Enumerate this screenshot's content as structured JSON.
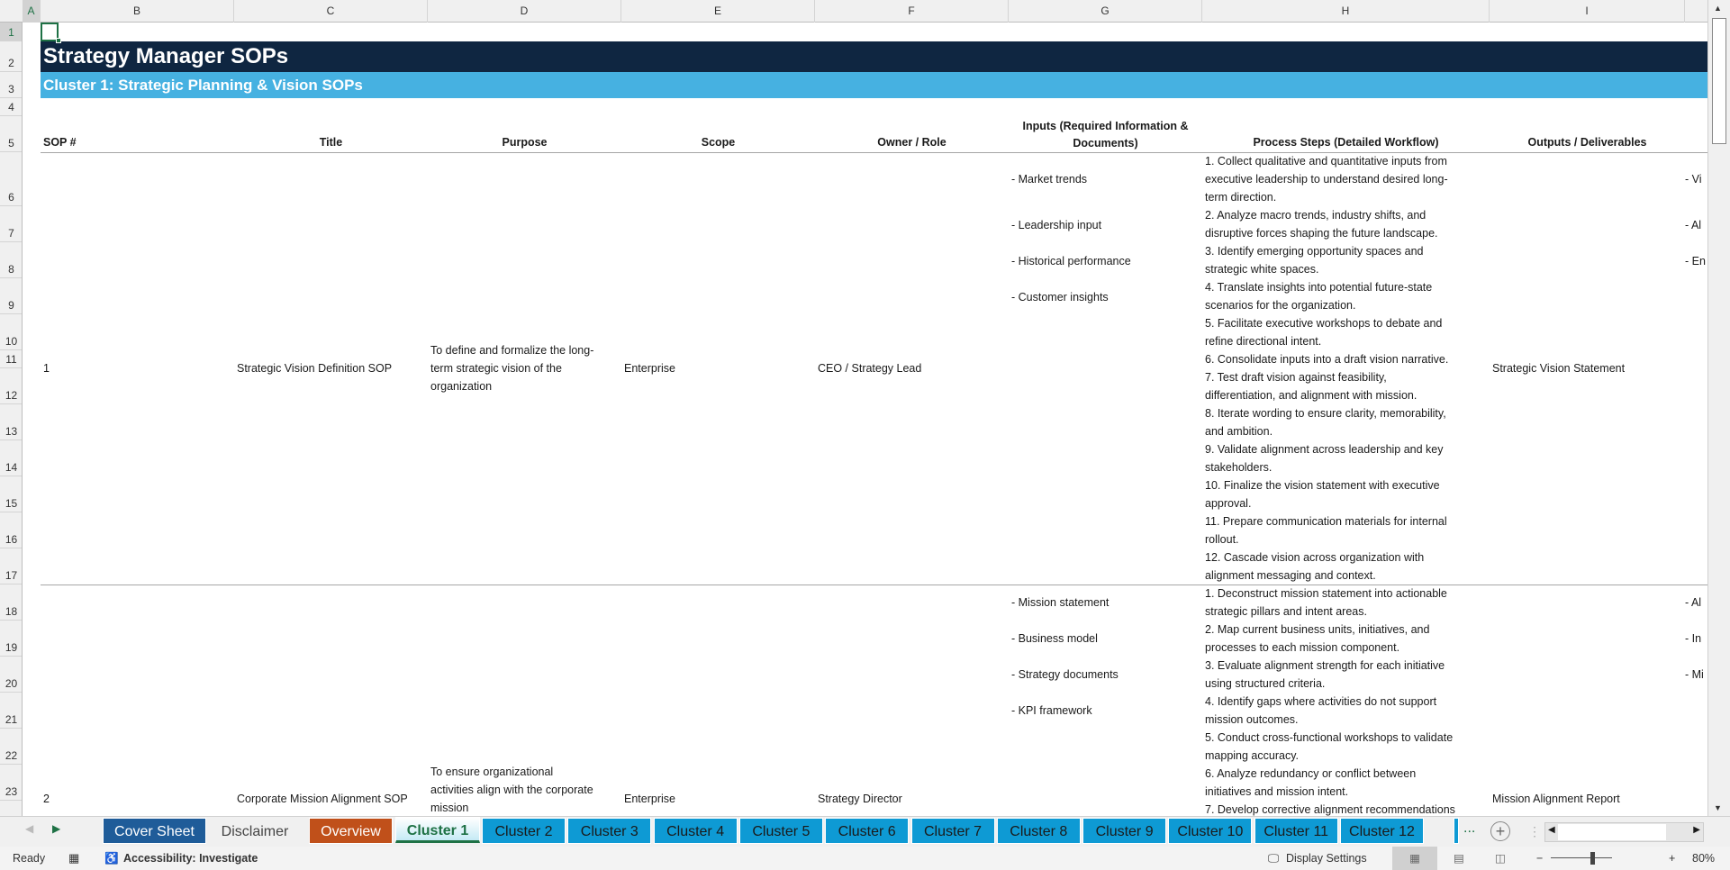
{
  "columns": [
    "A",
    "B",
    "C",
    "D",
    "E",
    "F",
    "G",
    "H",
    "I"
  ],
  "rows": [
    "1",
    "2",
    "3",
    "4",
    "5",
    "6",
    "7",
    "8",
    "9",
    "10",
    "11",
    "12",
    "13",
    "14",
    "15",
    "16",
    "17",
    "18",
    "19",
    "20",
    "21",
    "22",
    "23"
  ],
  "sheet": {
    "title": "Strategy Manager SOPs",
    "subtitle": "Cluster 1: Strategic Planning & Vision SOPs",
    "headers": {
      "sop": "SOP #",
      "title": "Title",
      "purpose": "Purpose",
      "scope": "Scope",
      "owner": "Owner / Role",
      "inputs": "Inputs (Required Information & Documents)",
      "steps": "Process Steps (Detailed Workflow)",
      "outputs": "Outputs / Deliverables"
    },
    "sops": [
      {
        "num": "1",
        "title": "Strategic Vision Definition SOP",
        "purpose": [
          "To define and formalize the long-",
          "term strategic vision of the",
          "organization"
        ],
        "scope": "Enterprise",
        "owner": "CEO / Strategy Lead",
        "inputs": [
          "- Market trends",
          "- Leadership input",
          "- Historical performance",
          "- Customer insights"
        ],
        "steps": [
          "1. Collect qualitative and quantitative inputs from",
          "executive leadership to understand desired long-",
          "term direction.",
          "2. Analyze macro trends, industry shifts, and",
          "disruptive forces shaping the future landscape.",
          "3. Identify emerging opportunity spaces and",
          "strategic white spaces.",
          "4. Translate insights into potential future-state",
          "scenarios for the organization.",
          "5. Facilitate executive workshops to debate and",
          "refine directional intent.",
          "6. Consolidate inputs into a draft vision narrative.",
          "7. Test draft vision against feasibility,",
          "differentiation, and alignment with mission.",
          "8. Iterate wording to ensure clarity, memorability,",
          "and ambition.",
          "9. Validate alignment across leadership and key",
          "stakeholders.",
          "10. Finalize the vision statement with executive",
          "approval.",
          "11. Prepare communication materials for internal",
          "rollout.",
          "12. Cascade vision across organization with",
          "alignment messaging and context."
        ],
        "outputs": "Strategic Vision Statement",
        "next_col": [
          "- Vi",
          "- Al",
          "- En"
        ]
      },
      {
        "num": "2",
        "title": "Corporate Mission Alignment SOP",
        "purpose": [
          "To ensure organizational",
          "activities align with the corporate",
          "mission"
        ],
        "scope": "Enterprise",
        "owner": "Strategy Director",
        "inputs": [
          "- Mission statement",
          "- Business model",
          "- Strategy documents",
          "- KPI framework"
        ],
        "steps": [
          "1. Deconstruct mission statement into actionable",
          "strategic pillars and intent areas.",
          "2. Map current business units, initiatives, and",
          "processes to each mission component.",
          "3. Evaluate alignment strength for each initiative",
          "using structured criteria.",
          "4. Identify gaps where activities do not support",
          "mission outcomes.",
          "5. Conduct cross-functional workshops to validate",
          "mapping accuracy.",
          "6. Analyze redundancy or conflict between",
          "initiatives and mission intent.",
          "7. Develop corrective alignment recommendations"
        ],
        "outputs": "Mission Alignment Report",
        "next_col": [
          "- Al",
          "- In",
          "- Mi"
        ]
      }
    ]
  },
  "tabs": [
    "Cover Sheet",
    "Disclaimer",
    "Overview",
    "Cluster 1",
    "Cluster 2",
    "Cluster 3",
    "Cluster 4",
    "Cluster 5",
    "Cluster 6",
    "Cluster 7",
    "Cluster 8",
    "Cluster 9",
    "Cluster 10",
    "Cluster 11",
    "Cluster 12"
  ],
  "tabs_more": "...",
  "status": {
    "ready": "Ready",
    "accessibility": "Accessibility: Investigate",
    "display_settings": "Display Settings",
    "zoom": "80%"
  },
  "colors": {
    "title_bg": "#0f2641",
    "subtitle_bg": "#46b1e1",
    "cover_tab": "#1f5c99",
    "overview_tab": "#c0501a",
    "cluster_tab": "#0e9ad4",
    "active_text": "#1e7145"
  }
}
